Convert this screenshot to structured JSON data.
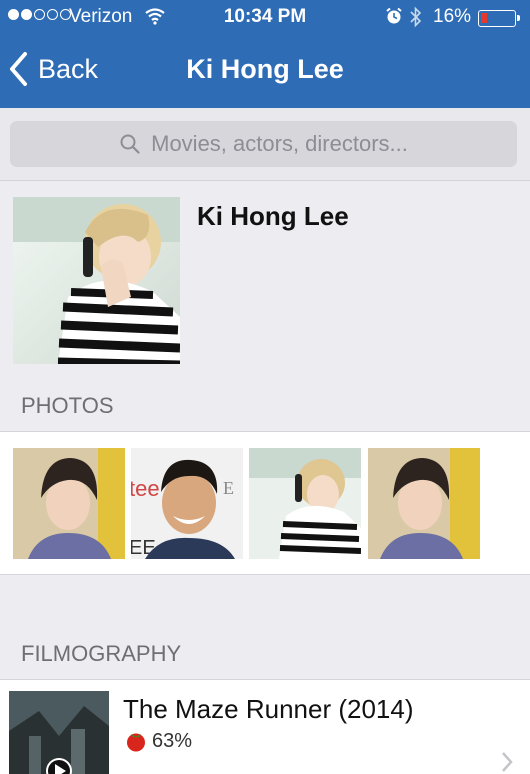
{
  "status_bar": {
    "carrier": "Verizon",
    "time": "10:34 PM",
    "battery_percent": "16%",
    "signal_bars_filled": 2,
    "signal_bars_total": 5,
    "battery_level": 0.16,
    "icons": [
      "signal-dots-icon",
      "wifi-icon",
      "alarm-icon",
      "bluetooth-icon",
      "battery-icon"
    ]
  },
  "nav": {
    "back_label": "Back",
    "title": "Ki Hong Lee"
  },
  "search": {
    "placeholder": "Movies, actors, directors..."
  },
  "profile": {
    "name": "Ki Hong Lee"
  },
  "photos": {
    "header": "PHOTOS",
    "items": [
      "photo-1",
      "photo-2",
      "photo-3",
      "photo-4"
    ]
  },
  "filmography": {
    "header": "FILMOGRAPHY",
    "items": [
      {
        "title": "The Maze Runner (2014)",
        "score": "63%",
        "score_icon": "tomato-icon"
      }
    ]
  },
  "colors": {
    "header_bg": "#2e6db5",
    "page_bg": "#ececf1",
    "battery_low": "#e23b2e"
  }
}
